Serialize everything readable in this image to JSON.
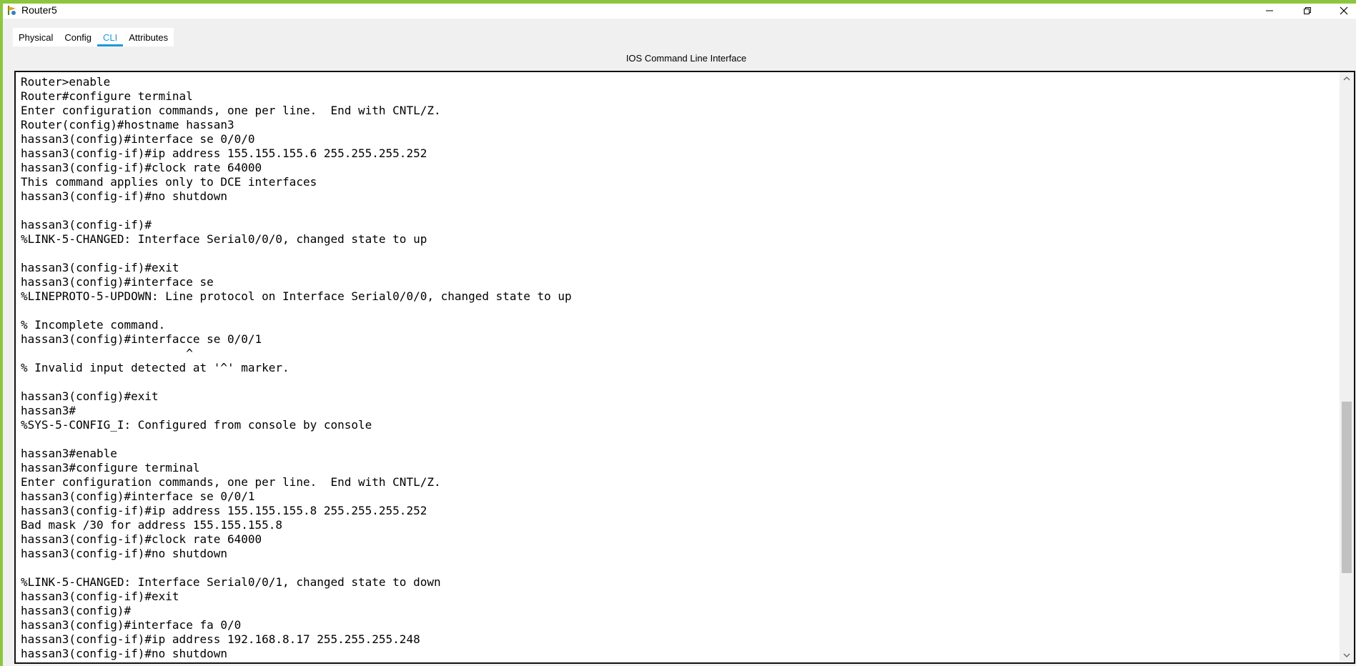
{
  "window": {
    "title": "Router5",
    "icon": "packet-tracer-router-icon",
    "controls": [
      "minimize-icon",
      "restore-icon",
      "close-icon"
    ]
  },
  "tabs": [
    {
      "label": "Physical"
    },
    {
      "label": "Config"
    },
    {
      "label": "CLI",
      "active": true
    },
    {
      "label": "Attributes"
    }
  ],
  "panel": {
    "title": "IOS Command Line Interface"
  },
  "terminal": {
    "output": "Router>enable\nRouter#configure terminal\nEnter configuration commands, one per line.  End with CNTL/Z.\nRouter(config)#hostname hassan3\nhassan3(config)#interface se 0/0/0\nhassan3(config-if)#ip address 155.155.155.6 255.255.255.252\nhassan3(config-if)#clock rate 64000\nThis command applies only to DCE interfaces\nhassan3(config-if)#no shutdown\n\nhassan3(config-if)#\n%LINK-5-CHANGED: Interface Serial0/0/0, changed state to up\n\nhassan3(config-if)#exit\nhassan3(config)#interface se\n%LINEPROTO-5-UPDOWN: Line protocol on Interface Serial0/0/0, changed state to up\n\n% Incomplete command.\nhassan3(config)#interfacce se 0/0/1\n                        ^\n% Invalid input detected at '^' marker.\n\nhassan3(config)#exit\nhassan3#\n%SYS-5-CONFIG_I: Configured from console by console\n\nhassan3#enable\nhassan3#configure terminal\nEnter configuration commands, one per line.  End with CNTL/Z.\nhassan3(config)#interface se 0/0/1\nhassan3(config-if)#ip address 155.155.155.8 255.255.255.252\nBad mask /30 for address 155.155.155.8\nhassan3(config-if)#clock rate 64000\nhassan3(config-if)#no shutdown\n\n%LINK-5-CHANGED: Interface Serial0/0/1, changed state to down\nhassan3(config-if)#exit\nhassan3(config)#\nhassan3(config)#interface fa 0/0\nhassan3(config-if)#ip address 192.168.8.17 255.255.255.248\nhassan3(config-if)#no shutdown"
  },
  "colors": {
    "frame_accent": "#8cc63f",
    "active_tab": "#1e9ad6"
  }
}
